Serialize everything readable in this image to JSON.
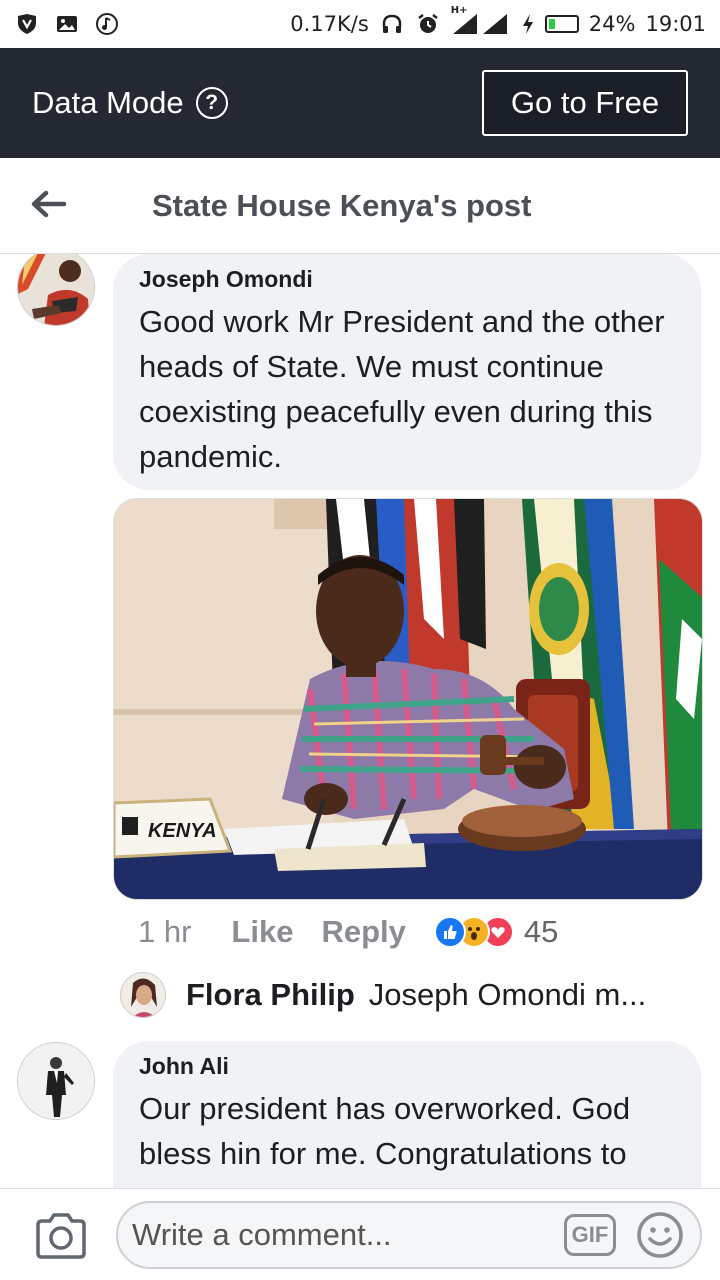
{
  "status_bar": {
    "speed": "0.17K/s",
    "network": "H+",
    "battery": "24%",
    "battery_level": 0.24,
    "time": "19:01",
    "icons": [
      "vpn-shield-icon",
      "image-icon",
      "music-icon",
      "headphones-icon",
      "alarm-icon",
      "signal-icon",
      "charging-icon",
      "battery-icon"
    ]
  },
  "data_mode": {
    "label": "Data Mode",
    "help_glyph": "?",
    "go_free_label": "Go to Free"
  },
  "header": {
    "title": "State House Kenya's post"
  },
  "comments": [
    {
      "author": "Joseph Omondi",
      "text": "Good work Mr President and the other heads of State. We must continue coexisting peacefully even during this pandemic.",
      "photo_nameplate": "KENYA",
      "time": "1 hr",
      "like_label": "Like",
      "reply_label": "Reply",
      "reactions": [
        "like",
        "wow",
        "love"
      ],
      "reaction_count": "45",
      "reply": {
        "author": "Flora Philip",
        "text": "Joseph Omondi m..."
      }
    },
    {
      "author": "John Ali",
      "text": "Our president has overworked. God bless hin for me. Congratulations to"
    }
  ],
  "composer": {
    "placeholder": "Write a comment...",
    "gif_label": "GIF"
  },
  "colors": {
    "top_bar": "#232833",
    "bubble": "#f0f2f5",
    "header_title": "#4b4f56",
    "muted": "#8a8d91",
    "like_blue": "#1877f2",
    "love_red": "#f33e58",
    "wow_yellow": "#f7b125"
  }
}
